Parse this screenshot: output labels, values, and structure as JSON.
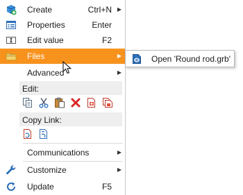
{
  "menu": {
    "items": [
      {
        "label": "Create",
        "shortcut": "Ctrl+N",
        "icon": "create-icon"
      },
      {
        "label": "Properties",
        "shortcut": "Enter",
        "icon": "properties-icon"
      },
      {
        "label": "Edit value",
        "shortcut": "F2",
        "icon": "edit-value-icon"
      },
      {
        "label": "Files",
        "shortcut": "",
        "icon": "folder-icon"
      },
      {
        "label": "Advanced",
        "shortcut": ""
      },
      {
        "label": "Communications",
        "shortcut": ""
      },
      {
        "label": "Customize",
        "shortcut": "",
        "icon": "wrench-icon"
      },
      {
        "label": "Update",
        "shortcut": "F5",
        "icon": "refresh-icon"
      }
    ],
    "edit_section": {
      "label": "Edit:",
      "tools": [
        "copy-icon",
        "cut-icon",
        "paste-icon",
        "delete-icon",
        "paste-special-icon",
        "duplicate-icon"
      ]
    },
    "copy_link_section": {
      "label": "Copy Link:",
      "tools": [
        "copy-link-icon",
        "copy-link-text-icon"
      ]
    }
  },
  "submenu": {
    "items": [
      {
        "label": "Open 'Round rod.grb'",
        "icon": "grb-file-icon"
      }
    ]
  },
  "colors": {
    "highlight": "#f7921d",
    "section_bg": "#eeeeee"
  }
}
